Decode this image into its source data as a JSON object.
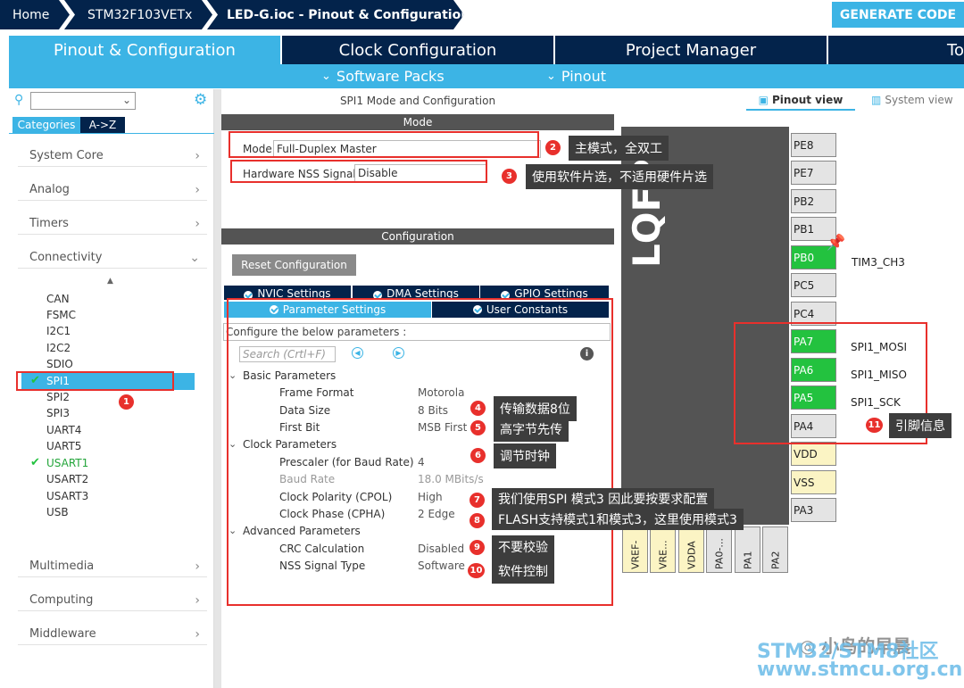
{
  "breadcrumb": {
    "home": "Home",
    "device": "STM32F103VETx",
    "file": "LED-G.ioc - Pinout & Configuration",
    "generate": "GENERATE CODE"
  },
  "tabs": [
    "Pinout & Configuration",
    "Clock Configuration",
    "Project Manager",
    "To"
  ],
  "subtabs": {
    "software_packs": "Software Packs",
    "pinout": "Pinout"
  },
  "left": {
    "tab_categories": "Categories",
    "tab_az": "A->Z",
    "categories": [
      "System Core",
      "Analog",
      "Timers",
      "Connectivity",
      "Multimedia",
      "Computing",
      "Middleware"
    ],
    "connectivity_items": [
      "CAN",
      "FSMC",
      "I2C1",
      "I2C2",
      "SDIO",
      "SPI1",
      "SPI2",
      "SPI3",
      "UART4",
      "UART5",
      "USART1",
      "USART2",
      "USART3",
      "USB"
    ]
  },
  "mid": {
    "title": "SPI1 Mode and Configuration",
    "mode_header": "Mode",
    "mode_label": "Mode",
    "mode_value": "Full-Duplex Master",
    "nss_label": "Hardware NSS Signal",
    "nss_value": "Disable",
    "config_header": "Configuration",
    "reset_btn": "Reset Configuration",
    "tabs_row1": [
      "NVIC Settings",
      "DMA Settings",
      "GPIO Settings"
    ],
    "tabs_row2": [
      "Parameter Settings",
      "User Constants"
    ],
    "configure_text": "Configure the below parameters :",
    "search_placeholder": "Search (Crtl+F)",
    "groups": {
      "basic": "Basic Parameters",
      "clock": "Clock Parameters",
      "advanced": "Advanced Parameters"
    },
    "params": [
      {
        "name": "Frame Format",
        "value": "Motorola"
      },
      {
        "name": "Data Size",
        "value": "8 Bits"
      },
      {
        "name": "First Bit",
        "value": "MSB First"
      },
      {
        "name": "Prescaler (for Baud Rate)",
        "value": "4"
      },
      {
        "name": "Baud Rate",
        "value": "18.0 MBits/s"
      },
      {
        "name": "Clock Polarity (CPOL)",
        "value": "High"
      },
      {
        "name": "Clock Phase (CPHA)",
        "value": "2 Edge"
      },
      {
        "name": "CRC Calculation",
        "value": "Disabled"
      },
      {
        "name": "NSS Signal Type",
        "value": "Software"
      }
    ]
  },
  "annotations": [
    {
      "num": "1",
      "text": ""
    },
    {
      "num": "2",
      "text": "主模式，全双工"
    },
    {
      "num": "3",
      "text": "使用软件片选，不适用硬件片选"
    },
    {
      "num": "4",
      "text": "传输数据8位"
    },
    {
      "num": "5",
      "text": "高字节先传"
    },
    {
      "num": "6",
      "text": "调节时钟"
    },
    {
      "num": "7",
      "text": "我们使用SPI 模式3 因此要按要求配置"
    },
    {
      "num": "8",
      "text": "FLASH支持模式1和模式3，这里使用模式3"
    },
    {
      "num": "9",
      "text": "不要校验"
    },
    {
      "num": "10",
      "text": "软件控制"
    },
    {
      "num": "11",
      "text": "引脚信息"
    }
  ],
  "right": {
    "pinout_view": "Pinout view",
    "system_view": "System view",
    "chip_label": "LQFP",
    "pins_right": [
      "PE8",
      "PE7",
      "PB2",
      "PB1",
      "PB0",
      "PC5",
      "PC4",
      "PA7",
      "PA6",
      "PA5",
      "PA4",
      "VDD",
      "VSS",
      "PA3"
    ],
    "pin_labels": {
      "PB0": "TIM3_CH3",
      "PA7": "SPI1_MOSI",
      "PA6": "SPI1_MISO",
      "PA5": "SPI1_SCK"
    },
    "pins_bottom": [
      "VREF-",
      "VRE...",
      "VDDA",
      "PA0-...",
      "PA1",
      "PA2"
    ]
  },
  "watermark": {
    "line1": "STM32/STM8社区",
    "line2": "www.stmcu.org.cn",
    "wechat": "小鸟的早晨"
  },
  "colors": {
    "navy": "#03234b",
    "accent": "#3cb4e5",
    "pin_green": "#23c23f",
    "annotation_red": "#e8302c"
  }
}
